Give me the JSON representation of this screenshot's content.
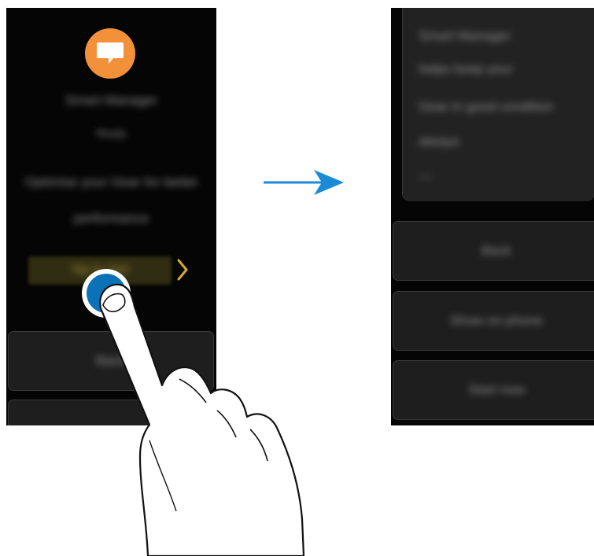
{
  "left_screen": {
    "app_icon": "chat-bubble-icon",
    "lines": [
      "Smart Manager",
      "Ready",
      "Optimise your Gear for better",
      "performance"
    ],
    "action_pill": "Tap to start",
    "chevron_icon": "chevron-right-icon",
    "button_1": "Back",
    "button_2": ""
  },
  "right_screen": {
    "card_lines": [
      "Smart Manager",
      "helps keep your",
      "Gear in good condition",
      "always",
      "—"
    ],
    "buttons": [
      "Back",
      "Show on phone",
      "Start now"
    ]
  },
  "colors": {
    "accent_orange": "#f3913b",
    "touch_blue": "#0c72b8",
    "arrow_blue": "#1b8bd6",
    "chevron_yellow": "#d9a928"
  },
  "arrow_icon": "arrow-right-icon",
  "hand_icon": "pointing-hand-icon"
}
